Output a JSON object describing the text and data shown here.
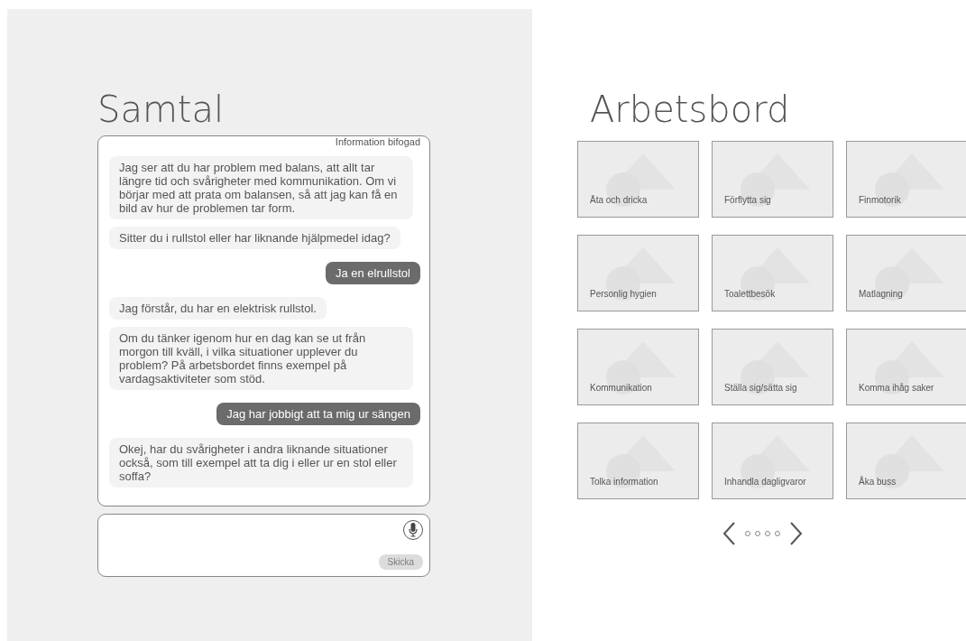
{
  "conversation": {
    "title": "Samtal",
    "attachment_note": "Information bifogad",
    "messages": [
      {
        "kind": "bot",
        "text": "Jag ser att du har problem med balans, att allt tar längre tid och svårigheter med kommunikation. Om vi börjar med att prata om balansen, så att jag kan få en bild av hur de problemen tar form."
      },
      {
        "kind": "bot",
        "text": "Sitter du i rullstol eller har liknande hjälpmedel idag?"
      },
      {
        "kind": "user",
        "text": "Ja en elrullstol"
      },
      {
        "kind": "bot",
        "text": "Jag förstår, du har en elektrisk rullstol."
      },
      {
        "kind": "bot",
        "text": "Om du tänker igenom hur en dag kan se ut från morgon till kväll, i vilka situationer upplever du problem? På arbetsbordet finns exempel på vardagsaktiviteter som stöd."
      },
      {
        "kind": "user",
        "text": "Jag har jobbigt att ta mig ur sängen"
      },
      {
        "kind": "bot",
        "text": "Okej, har du svårigheter i andra liknande situationer också, som till exempel att ta dig i eller ur en stol eller soffa?"
      }
    ],
    "composer": {
      "send_label": "Skicka",
      "send_disabled": true
    }
  },
  "workbench": {
    "title": "Arbetsbord",
    "tiles": [
      {
        "label": "Äta och dricka"
      },
      {
        "label": "Förflytta sig"
      },
      {
        "label": "Finmotorik"
      },
      {
        "label": "Personlig hygien"
      },
      {
        "label": "Toalettbesök"
      },
      {
        "label": "Matlagning"
      },
      {
        "label": "Kommunikation"
      },
      {
        "label": "Ställa sig/sätta sig"
      },
      {
        "label": "Komma ihåg saker"
      },
      {
        "label": "Tolka information"
      },
      {
        "label": "Inhandla dagligvaror"
      },
      {
        "label": "Åka buss"
      }
    ],
    "page_dots": [
      {
        "selected": false
      },
      {
        "selected": false
      },
      {
        "selected": false
      },
      {
        "selected": false
      }
    ]
  }
}
